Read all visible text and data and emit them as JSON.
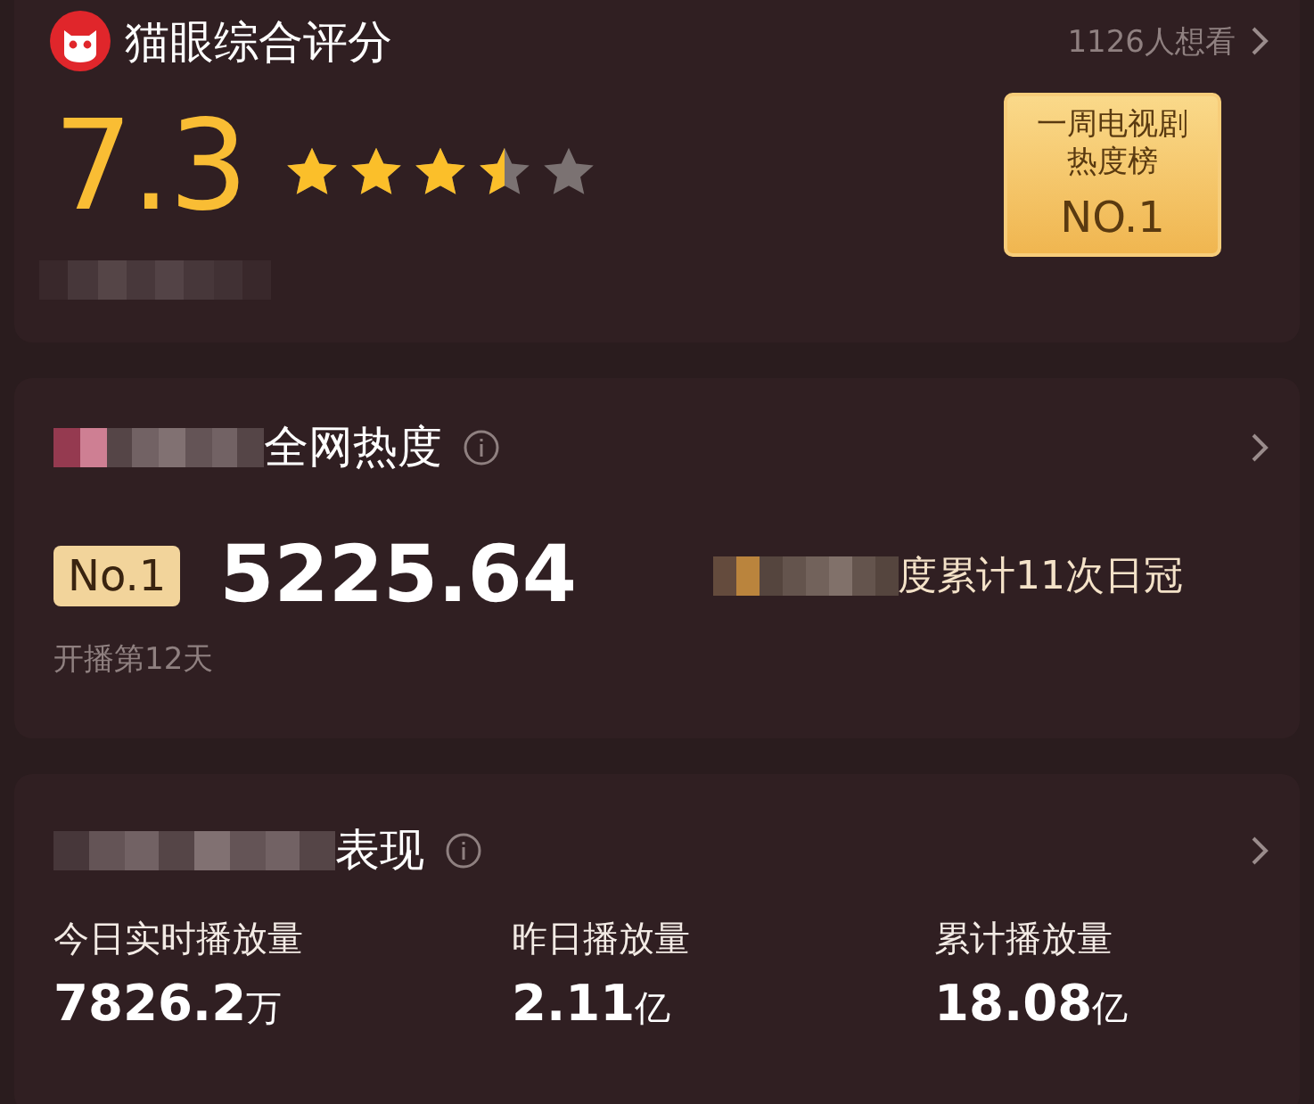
{
  "rating": {
    "title": "猫眼综合评分",
    "want_count": "1126人想看",
    "score": "7.3",
    "stars": 3.5,
    "badge": {
      "lines": [
        "一周电视剧",
        "热度榜"
      ],
      "rank": "NO.1"
    }
  },
  "heat": {
    "title": "全网热度",
    "rank": "No.1",
    "value": "5225.64",
    "note": "度累计11次日冠",
    "days": "开播第12天"
  },
  "performance": {
    "title": "表现",
    "stats": [
      {
        "label": "今日实时播放量",
        "number": "7826.2",
        "unit": "万"
      },
      {
        "label": "昨日播放量",
        "number": "2.11",
        "unit": "亿"
      },
      {
        "label": "累计播放量",
        "number": "18.08",
        "unit": "亿"
      }
    ]
  }
}
